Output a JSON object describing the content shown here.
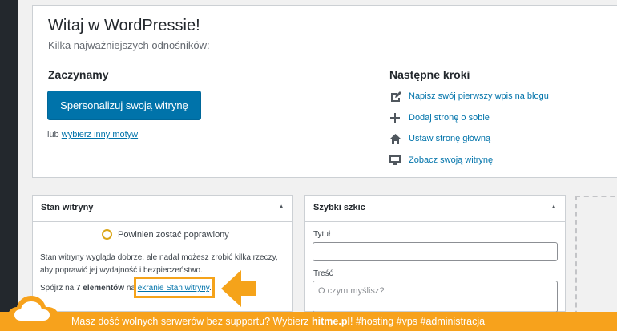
{
  "welcome": {
    "title": "Witaj w WordPressie!",
    "subtitle": "Kilka najważniejszych odnośników:",
    "get_started": {
      "heading": "Zaczynamy",
      "button_label": "Spersonalizuj swoją witrynę",
      "or_text": "lub ",
      "or_link": "wybierz inny motyw"
    },
    "next_steps": {
      "heading": "Następne kroki",
      "items": [
        {
          "icon": "edit-icon",
          "label": "Napisz swój pierwszy wpis na blogu"
        },
        {
          "icon": "plus-icon",
          "label": "Dodaj stronę o sobie"
        },
        {
          "icon": "home-icon",
          "label": "Ustaw stronę główną"
        },
        {
          "icon": "view-site-icon",
          "label": "Zobacz swoją witrynę"
        }
      ]
    }
  },
  "site_health": {
    "title": "Stan witryny",
    "status": "Powinien zostać poprawiony",
    "description": "Stan witryny wygląda dobrze, ale nadal możesz zrobić kilka rzeczy, aby poprawić jej wydajność i bezpieczeństwo.",
    "more_prefix": "Spójrz na ",
    "more_count": "7 elementów",
    "more_mid": " na ",
    "more_link": "ekranie Stan witryny",
    "more_suffix": "."
  },
  "quick_draft": {
    "title": "Szybki szkic",
    "title_label": "Tytuł",
    "title_value": "",
    "content_label": "Treść",
    "content_placeholder": "O czym myślisz?"
  },
  "banner": {
    "prefix": "Masz dość wolnych serwerów bez supportu? Wybierz ",
    "brand": "hitme.pl",
    "suffix": "!   #hosting #vps #administracja"
  },
  "colors": {
    "primary": "#0073aa",
    "warning": "#dba617",
    "banner": "#f7a21c"
  }
}
